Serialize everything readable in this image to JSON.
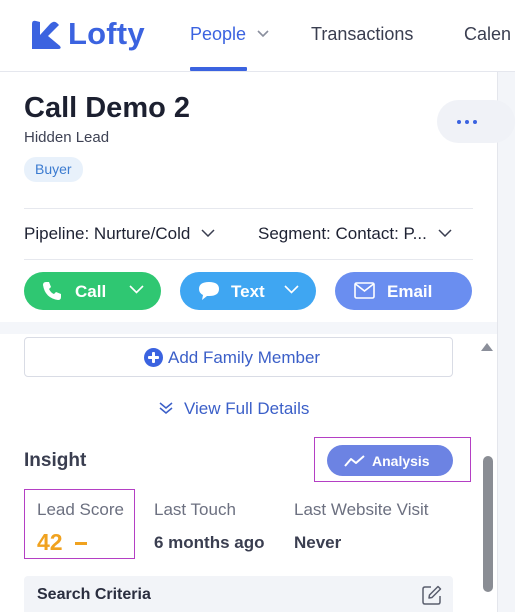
{
  "nav": {
    "logo_text": "Lofty",
    "items": [
      {
        "label": "People",
        "active": true
      },
      {
        "label": "Transactions"
      },
      {
        "label": "Calen"
      }
    ]
  },
  "lead": {
    "name": "Call Demo 2",
    "status": "Hidden Lead",
    "tag": "Buyer",
    "pipeline": "Pipeline: Nurture/Cold",
    "segment": "Segment: Contact: P..."
  },
  "actions": {
    "call": "Call",
    "text": "Text",
    "email": "Email"
  },
  "family": {
    "add_label": "Add Family Member",
    "view_details": "View Full Details"
  },
  "insight": {
    "title": "Insight",
    "analysis_label": "Analysis",
    "metrics": {
      "lead_score_label": "Lead Score",
      "lead_score_value": "42",
      "last_touch_label": "Last Touch",
      "last_touch_value": "6 months ago",
      "last_visit_label": "Last Website Visit",
      "last_visit_value": "Never"
    }
  },
  "criteria": {
    "title": "Search Criteria"
  },
  "colors": {
    "brand": "#3b63e0",
    "call": "#2fc772",
    "text": "#3fa6f2",
    "email": "#6a8ef0",
    "lead_score": "#f0a21f",
    "highlight_box": "#b43fc4"
  }
}
